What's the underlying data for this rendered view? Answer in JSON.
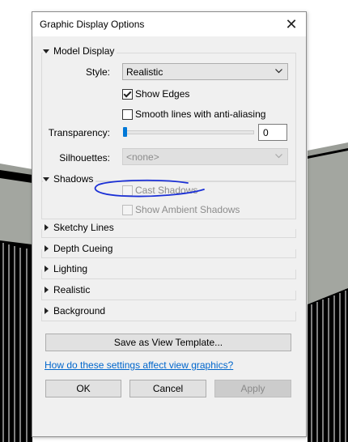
{
  "dialog": {
    "title": "Graphic Display Options",
    "close_glyph": "✕"
  },
  "model_display": {
    "header": "Model Display",
    "style_label": "Style:",
    "style_value": "Realistic",
    "show_edges_label": "Show Edges",
    "show_edges_checked": true,
    "smooth_lines_label": "Smooth lines with anti-aliasing",
    "smooth_lines_checked": false,
    "transparency_label": "Transparency:",
    "transparency_value": "0",
    "silhouettes_label": "Silhouettes:",
    "silhouettes_value": "<none>"
  },
  "shadows": {
    "header": "Shadows",
    "cast_shadows_label": "Cast Shadows",
    "cast_shadows_checked": false,
    "show_ambient_label": "Show Ambient Shadows",
    "show_ambient_checked": false
  },
  "collapsed_sections": [
    {
      "label": "Sketchy Lines"
    },
    {
      "label": "Depth Cueing"
    },
    {
      "label": "Lighting"
    },
    {
      "label": "Realistic"
    },
    {
      "label": "Background"
    }
  ],
  "buttons": {
    "save_template": "Save as View Template...",
    "help_link": "How do these settings affect view graphics?",
    "ok": "OK",
    "cancel": "Cancel",
    "apply": "Apply"
  },
  "colors": {
    "accent": "#0078d7",
    "link": "#0066cc",
    "annotation": "#1a2fd6"
  }
}
